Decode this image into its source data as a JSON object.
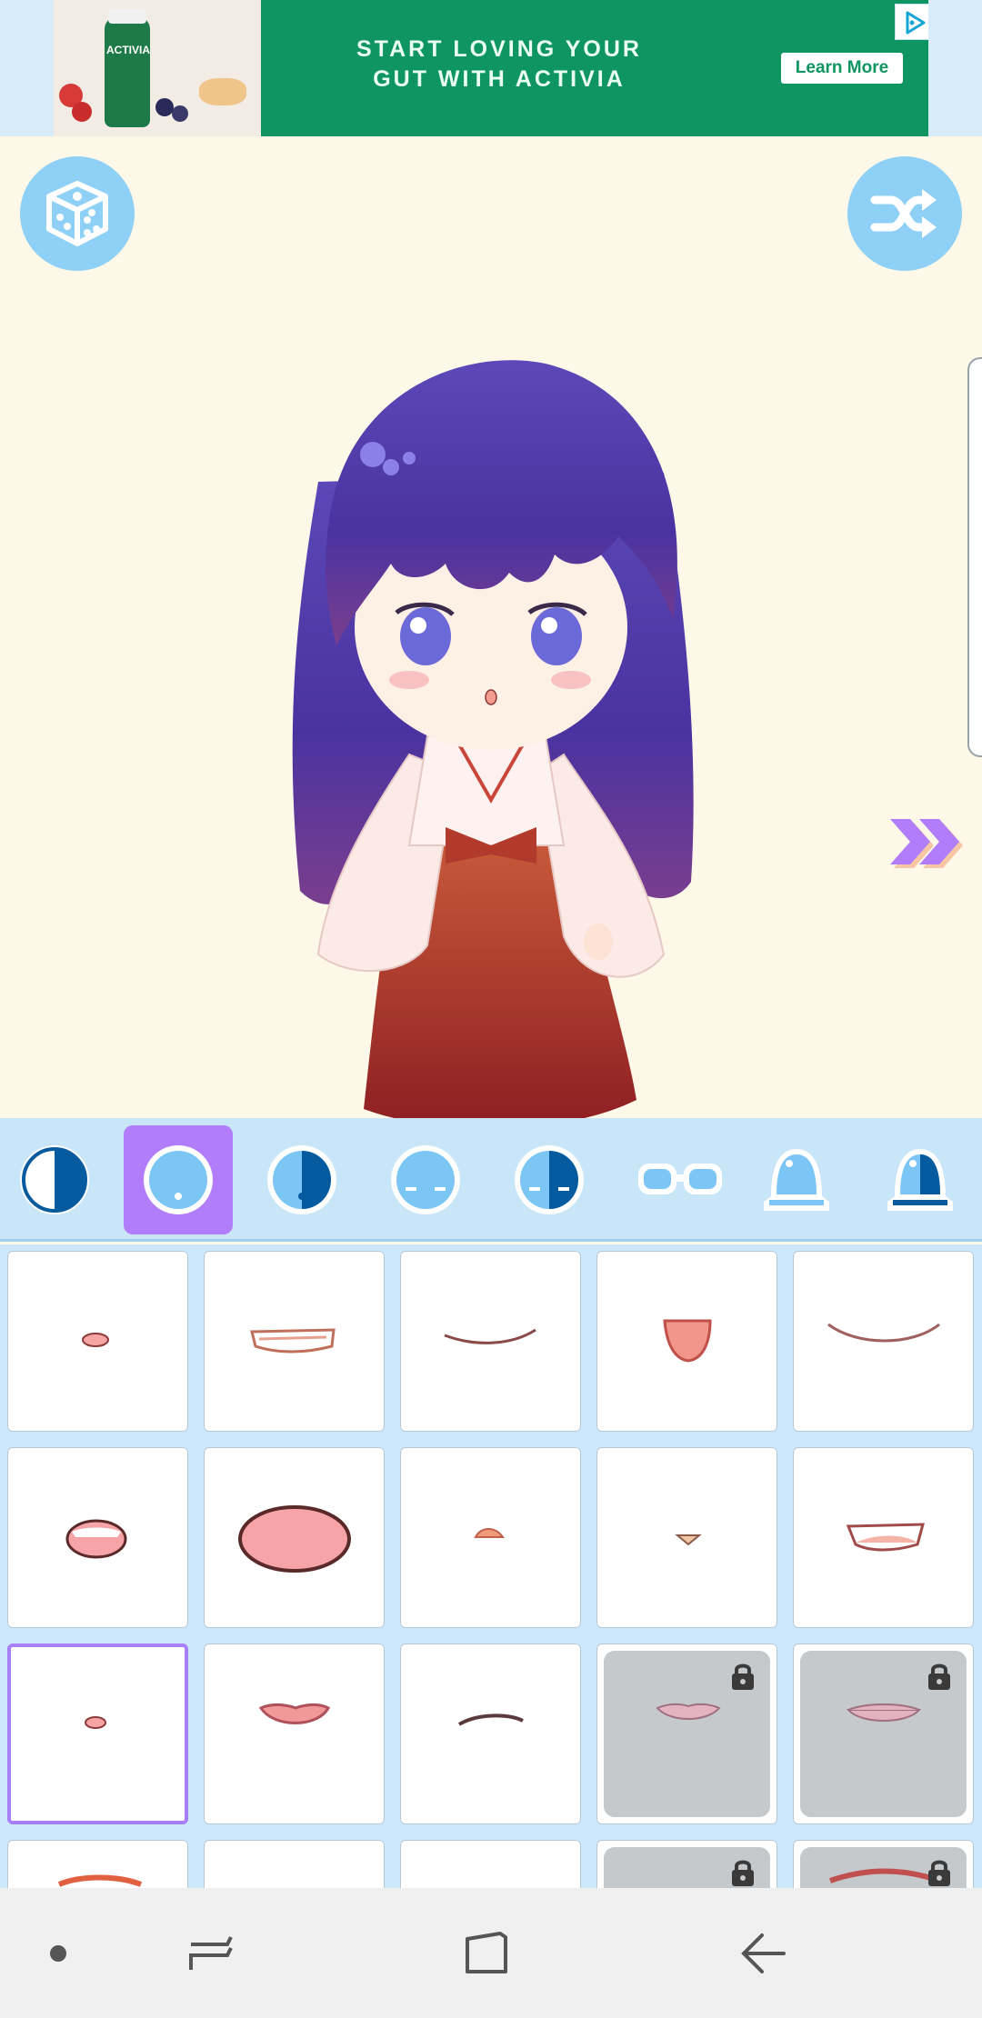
{
  "ad": {
    "headline_line1": "START LOVING YOUR",
    "headline_line2": "GUT WITH ACTIVIA",
    "cta": "Learn More",
    "bottle_label": "ACTIVIA",
    "close_symbol": "✕",
    "colors": {
      "background": "#0e9561",
      "accent": "#16a6d6"
    }
  },
  "toolbar": {
    "random_button_icon": "dice-icon",
    "shuffle_button_icon": "shuffle-icon",
    "next_icon": "double-chevron-right-icon"
  },
  "category_tabs": [
    {
      "icon": "face-blush-icon",
      "active": false
    },
    {
      "icon": "face-mouth-icon",
      "active": true
    },
    {
      "icon": "face-half-icon",
      "active": false
    },
    {
      "icon": "face-eyes-icon",
      "active": false
    },
    {
      "icon": "face-eyes-half-icon",
      "active": false
    },
    {
      "icon": "glasses-icon",
      "active": false
    },
    {
      "icon": "body-icon",
      "active": false
    },
    {
      "icon": "body-half-icon",
      "active": false
    }
  ],
  "mouth_options": {
    "selected_index": 10,
    "locked_indices": [
      13,
      14,
      18,
      19
    ],
    "items": [
      "mouth-small-icon",
      "mouth-grin-icon",
      "mouth-smile-line-icon",
      "mouth-open-icon",
      "mouth-wide-smile-icon",
      "mouth-teeth-icon",
      "mouth-big-open-icon",
      "mouth-tiny-icon",
      "mouth-dot-icon",
      "mouth-smirk-icon",
      "mouth-small-icon",
      "mouth-lips-icon",
      "mouth-frown-line-icon",
      "mouth-lips-locked-icon",
      "mouth-lips-locked-icon"
    ]
  },
  "navbar": {
    "items": [
      "recents-dot-icon",
      "recent-apps-icon",
      "home-icon",
      "back-icon"
    ]
  },
  "colors": {
    "canvas_bg": "#fdf8e7",
    "tab_active": "#b17dfb",
    "accent_blue": "#8fd1f6",
    "arrow_purple": "#b17dfb",
    "hair": "#5b3fb0",
    "skirt": "#b23a2c"
  }
}
